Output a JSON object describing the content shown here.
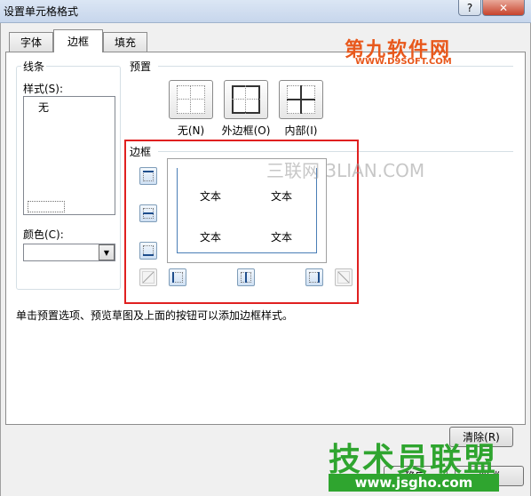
{
  "window": {
    "title": "设置单元格格式",
    "help_glyph": "?",
    "close_glyph": "✕"
  },
  "tabs": [
    {
      "label": "字体",
      "active": false
    },
    {
      "label": "边框",
      "active": true
    },
    {
      "label": "填充",
      "active": false
    }
  ],
  "line": {
    "group_label": "线条",
    "style_label": "样式(S):",
    "style_none": "无",
    "color_label": "颜色(C):",
    "color_value": ""
  },
  "presets": {
    "group_label": "预置",
    "items": [
      {
        "label": "无(N)",
        "icon": "preset-none-icon"
      },
      {
        "label": "外边框(O)",
        "icon": "preset-outline-icon"
      },
      {
        "label": "内部(I)",
        "icon": "preset-inside-icon"
      }
    ]
  },
  "border": {
    "group_label": "边框",
    "preview_texts": [
      "文本",
      "文本",
      "文本",
      "文本"
    ]
  },
  "hint": "单击预置选项、预览草图及上面的按钮可以添加边框样式。",
  "buttons": {
    "clear": "清除(R)",
    "ok": "确定",
    "cancel": "取消"
  },
  "watermarks": {
    "top": "第九软件网",
    "top_sub": "WWW.D9SOFT.COM",
    "middle": "三联网 3LIAN.COM",
    "bottom": "技术员联盟",
    "bottom_sub": "www.jsgho.com"
  },
  "colors": {
    "highlight_border": "#e02020",
    "selection_blue": "#4a7eb6",
    "watermark_orange": "#e8581c",
    "watermark_green": "#2fa52f"
  }
}
